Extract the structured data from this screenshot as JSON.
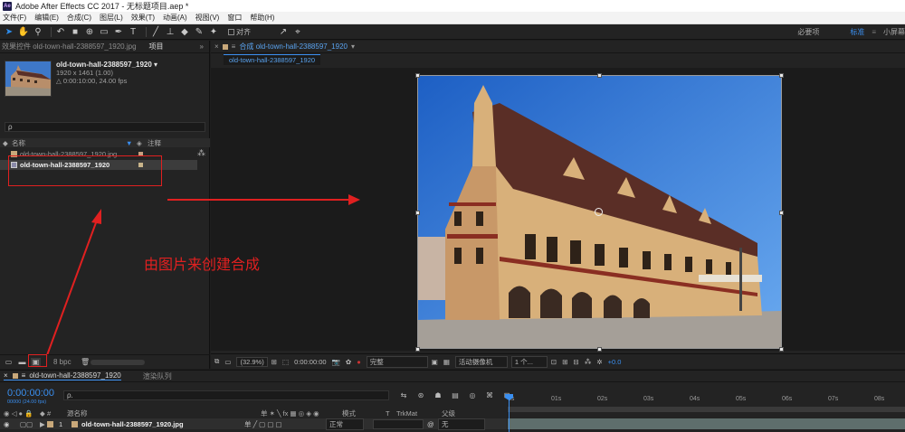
{
  "window": {
    "app_icon": "Ae",
    "title": "Adobe After Effects CC 2017 - 无标题项目.aep *"
  },
  "menu": [
    "文件(F)",
    "编辑(E)",
    "合成(C)",
    "图层(L)",
    "效果(T)",
    "动画(A)",
    "视图(V)",
    "窗口",
    "帮助(H)"
  ],
  "toolbar": {
    "tools": [
      "selection-tool",
      "hand-tool",
      "zoom-tool",
      "rotation-tool",
      "camera-tool",
      "pan-behind-tool",
      "rectangle-tool",
      "pen-tool",
      "type-tool",
      "brush-tool",
      "clone-stamp-tool",
      "eraser-tool",
      "roto-brush-tool",
      "puppet-pin-tool"
    ],
    "align_label": "对齐",
    "workspaces": [
      "必要项",
      "标准",
      "小屏幕"
    ],
    "active_workspace": "标准"
  },
  "project_panel": {
    "tab_effects": "效果控件 old-town-hall-2388597_1920.jpg",
    "tab_project": "项目",
    "expand_glyph": "»",
    "selected_item": {
      "name": "old-town-hall-2388597_1920 ▾",
      "dims": "1920 x 1461 (1.00)",
      "duration": "△ 0:00:10:00, 24.00 fps"
    },
    "search_placeholder": "ρ",
    "col_name": "名称",
    "col_comment": "注释",
    "items": [
      {
        "name": "old-town-hall-2388597_1920.jpg",
        "type": "footage",
        "label_color": "#c8a080"
      },
      {
        "name": "old-town-hall-2388597_1920",
        "type": "composition",
        "label_color": "#c8b48a"
      }
    ],
    "bpc": "8 bpc"
  },
  "composition_panel": {
    "tab_label": "合成 old-town-hall-2388597_1920",
    "breadcrumb": "old-town-hall-2388597_1920",
    "zoom": "(32.9%)",
    "timecode": "0:00:00:00",
    "resolution": "完整",
    "camera": "活动摄像机",
    "views": "1 个...",
    "exposure": "+0.0"
  },
  "annotation": {
    "text": "由图片来创建合成",
    "color": "#e02020"
  },
  "timeline": {
    "tab_comp": "old-town-hall-2388597_1920",
    "tab_render": "渲染队列",
    "current_time": "0:00:00:00",
    "fps_label": "00000 (24.00 fps)",
    "search_placeholder": "ρ.",
    "header": {
      "num": "#",
      "source": "源名称",
      "mode": "模式",
      "t": "T",
      "trkmat": "TrkMat",
      "parent": "父级"
    },
    "layer": {
      "index": "1",
      "name": "old-town-hall-2388597_1920.jpg",
      "mode": "正常",
      "parent": "无"
    },
    "ruler": [
      "0s",
      "01s",
      "02s",
      "03s",
      "04s",
      "05s",
      "06s",
      "07s",
      "08s"
    ]
  }
}
